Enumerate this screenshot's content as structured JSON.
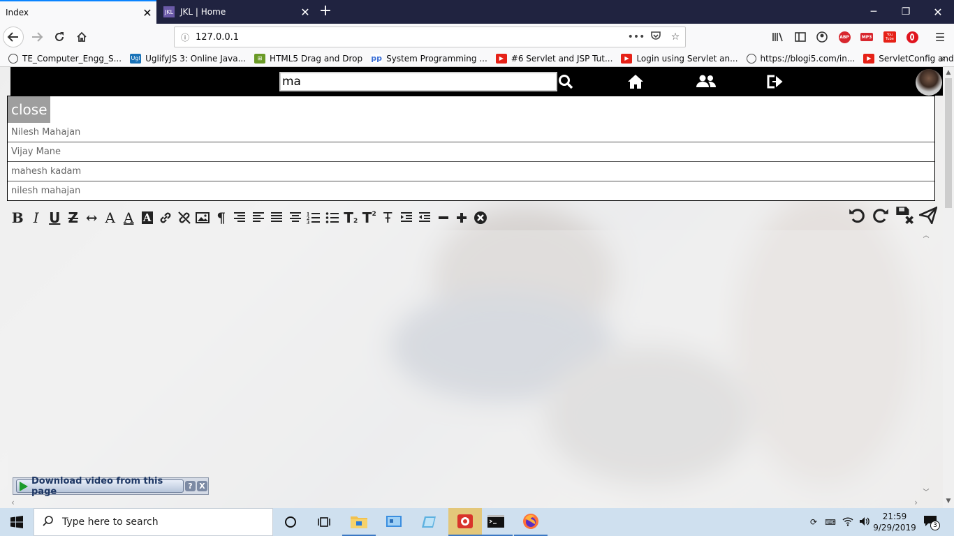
{
  "browser": {
    "tabs": [
      {
        "title": "Index",
        "active": true
      },
      {
        "title": "JKL | Home",
        "active": false,
        "favicon_text": "JKL"
      }
    ],
    "url": "127.0.0.1",
    "bookmarks": [
      {
        "label": "TE_Computer_Engg_S...",
        "icon": "globe-icon"
      },
      {
        "label": "UglifyJS 3: Online Java...",
        "icon": "uglify-icon",
        "icon_text": "Ugl"
      },
      {
        "label": "HTML5 Drag and Drop",
        "icon": "html5-icon"
      },
      {
        "label": "System Programming ...",
        "icon": "pp-icon",
        "icon_text": "pp"
      },
      {
        "label": "#6 Servlet and JSP Tut...",
        "icon": "youtube-icon"
      },
      {
        "label": "Login using Servlet an...",
        "icon": "youtube-icon"
      },
      {
        "label": "https://blogi5.com/in...",
        "icon": "globe-icon"
      },
      {
        "label": "ServletConfig and Serv...",
        "icon": "youtube-icon"
      }
    ],
    "toolbar_badges": {
      "abp": "ABP",
      "mp3": "MP3",
      "youtube": "You Tube"
    }
  },
  "app": {
    "search_value": "ma",
    "close_label": "close",
    "results": [
      "Nilesh Mahajan",
      "Vijay Mane",
      "mahesh kadam",
      "nilesh mahajan"
    ],
    "editor_tools_left": [
      "bold-icon",
      "italic-icon",
      "underline-icon",
      "strikethrough-icon",
      "horizontal-arrows-icon",
      "font-icon",
      "font-color-icon",
      "background-color-icon",
      "link-icon",
      "unlink-icon",
      "image-icon",
      "paragraph-icon",
      "align-right-icon",
      "align-left-icon",
      "justify-icon",
      "align-center-icon",
      "ordered-list-icon",
      "unordered-list-icon",
      "subscript-icon",
      "superscript-icon",
      "remove-format-icon",
      "indent-icon",
      "outdent-icon",
      "minus-icon",
      "plus-icon",
      "clear-icon"
    ],
    "editor_tools_right": [
      "undo-icon",
      "redo-icon",
      "save-cancel-icon",
      "send-icon"
    ],
    "download_label": "Download video from this page",
    "download_help": "?",
    "download_close": "X"
  },
  "taskbar": {
    "search_placeholder": "Type here to search",
    "time": "21:59",
    "date": "9/29/2019",
    "notification_count": "3"
  },
  "colors": {
    "tabstrip": "#202340",
    "accent": "#0a84ff",
    "appbar": "#000000",
    "close_button": "#9e9e9e"
  }
}
